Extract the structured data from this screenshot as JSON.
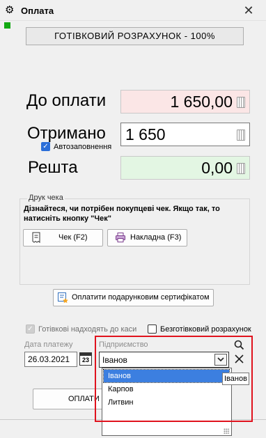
{
  "window": {
    "title": "Оплата",
    "close_symbol": "✕"
  },
  "payment_mode": {
    "label": "ГОТІВКОВИЙ РОЗРАХУНОК - 100%"
  },
  "amounts": {
    "to_pay_label": "До оплати",
    "to_pay_value": "1 650,00",
    "received_label": "Отримано",
    "received_value": "1 650",
    "autofill_label": "Автозаповнення",
    "change_label": "Решта",
    "change_value": "0,00"
  },
  "receipt_print": {
    "group_title": "Друк чека",
    "hint": "Дізнайтеся, чи потрібен покупцеві чек. Якщо так, то натисніть кнопку \"Чек\"",
    "receipt_button": "Чек (F2)",
    "invoice_button": "Накладна (F3)"
  },
  "gift_certificate_button": "Оплатити подарунковим сертифікатом",
  "options": {
    "cash_to_register_label": "Готівкові надходять до каси",
    "cashless_label": "Безготівковий розрахунок"
  },
  "payment_date": {
    "label": "Дата платежу",
    "value": "26.03.2021",
    "calendar_day": "23"
  },
  "enterprise": {
    "label": "Підприємство",
    "selected": "Іванов",
    "options": [
      "Іванов",
      "Карпов",
      "Литвин"
    ],
    "tooltip": "Іванов"
  },
  "pay_button": {
    "label": "ОПЛАТИ"
  },
  "colors": {
    "to_pay_bg": "#fbe6e6",
    "change_bg": "#e3f6e3",
    "accent": "#3c7fe0",
    "highlight": "#e0121d",
    "status_square": "#11a811"
  }
}
